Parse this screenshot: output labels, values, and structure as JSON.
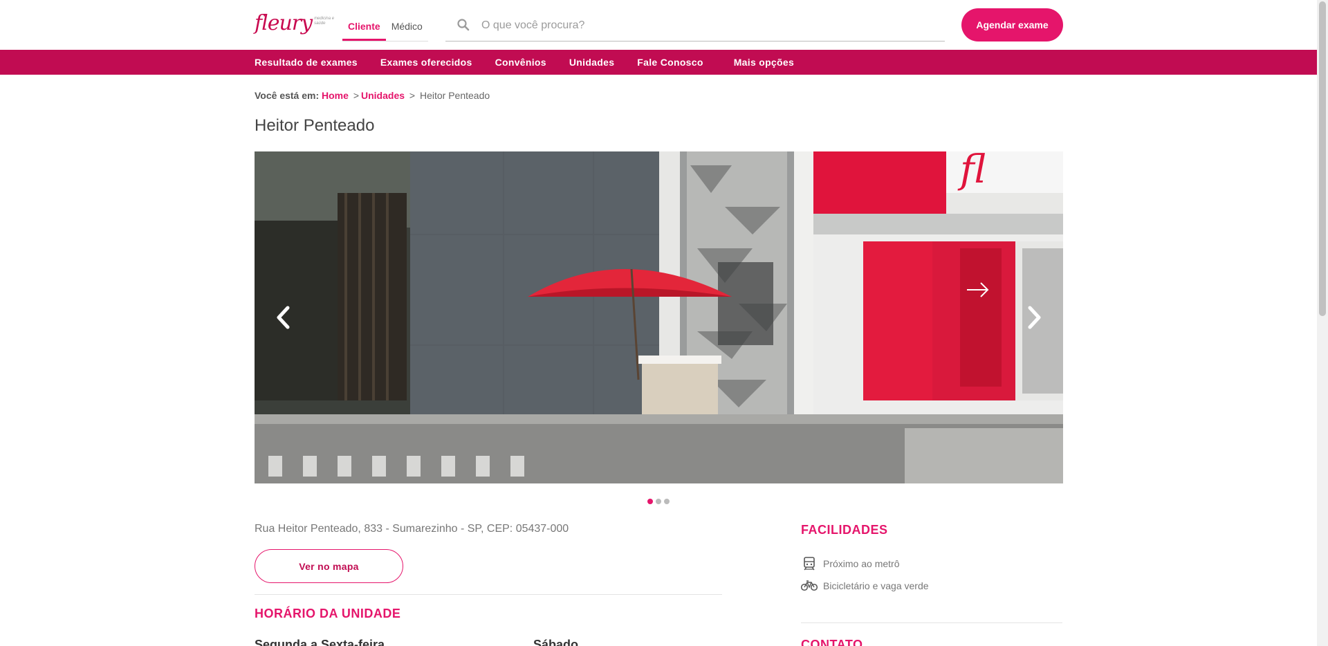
{
  "header": {
    "logo_text": "fleury",
    "logo_tagline": "medicina e saúde",
    "audience_tabs": [
      {
        "label": "Cliente",
        "active": true
      },
      {
        "label": "Médico",
        "active": false
      }
    ],
    "search": {
      "placeholder": "O que você procura?",
      "icon": "search-icon"
    },
    "cta_label": "Agendar exame"
  },
  "nav": {
    "items": [
      "Resultado de exames",
      "Exames oferecidos",
      "Convênios",
      "Unidades",
      "Fale Conosco",
      "Mais opções"
    ]
  },
  "breadcrumb": {
    "prefix": "Você está em:",
    "items": [
      "Home",
      "Unidades"
    ],
    "separator": ">",
    "current": "Heitor Penteado"
  },
  "page": {
    "title": "Heitor Penteado"
  },
  "carousel": {
    "slide_count": 3,
    "active_index": 0,
    "prev_icon": "chevron-left-icon",
    "next_icon": "chevron-right-icon"
  },
  "unit": {
    "address": "Rua Heitor Penteado, 833 - Sumarezinho - SP, CEP: 05437-000",
    "map_button": "Ver no mapa",
    "hours_title": "HORÁRIO DA UNIDADE",
    "hours_columns": [
      "Segunda a Sexta-feira",
      "Sábado"
    ]
  },
  "facilities": {
    "title": "FACILIDADES",
    "items": [
      {
        "label": "Próximo ao metrô",
        "icon": "train-icon"
      },
      {
        "label": "Bicicletário e vaga verde",
        "icon": "bicycle-icon"
      }
    ]
  },
  "contact": {
    "title": "CONTATO"
  },
  "colors": {
    "brand": "#e5156b",
    "nav_bg": "#c10c52"
  }
}
